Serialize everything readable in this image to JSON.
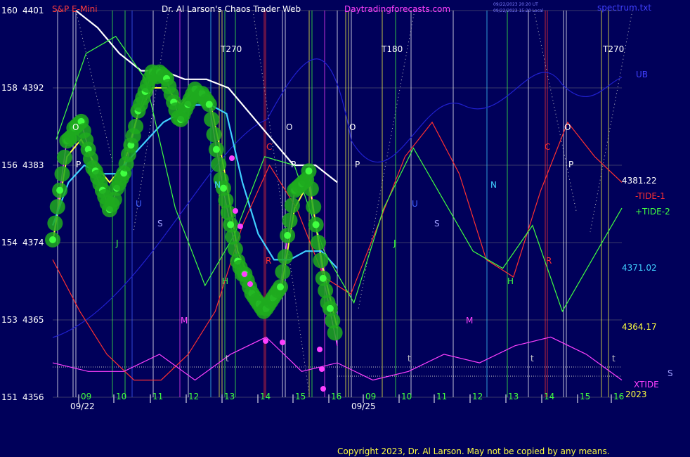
{
  "header": {
    "symbol": "S&P E-Mini",
    "title": "Dr. Al Larson's Chaos Trader Web",
    "site": "Daytradingforecasts.com",
    "timestamp_line1": "09/22/2023 20:20 UT",
    "timestamp_line2": "09/22/2023 15:20 Local",
    "topright": "spectrum.txt",
    "colors": {
      "symbol": "#ff3c3c",
      "title": "#ffffff",
      "site": "#ff40ff",
      "timestamp": "#7c7cff",
      "topright": "#4040ff"
    }
  },
  "left_axis": [
    {
      "cycle": "160",
      "price": "4401"
    },
    {
      "cycle": "158",
      "price": "4392"
    },
    {
      "cycle": "156",
      "price": "4383"
    },
    {
      "cycle": "154",
      "price": "4374"
    },
    {
      "cycle": "153",
      "price": "4365"
    },
    {
      "cycle": "151",
      "price": "4356"
    }
  ],
  "right_labels": {
    "ub": "UB",
    "price_white": "4381.22",
    "tide1": "-TIDE-1",
    "tide2": "+TIDE-2",
    "price_cyan": "4371.02",
    "price_yellow": "4364.17",
    "xtide": "XTIDE",
    "year": "2023",
    "s_edge": "S",
    "colors": {
      "ub": "#4040ff",
      "price_white": "#ffffff",
      "tide1": "#ff3030",
      "tide2": "#40ff40",
      "price_cyan": "#40d0ff",
      "price_yellow": "#ffff40",
      "xtide": "#ff40ff",
      "year": "#ffff40",
      "s_edge": "#a0a0ff"
    }
  },
  "hour_labels": [
    "09",
    "10",
    "11",
    "12",
    "13",
    "14",
    "15",
    "16",
    "09",
    "10",
    "11",
    "12",
    "13",
    "14",
    "15",
    "16"
  ],
  "date_labels": [
    "09/22",
    "09/25"
  ],
  "cycle_markers": [
    "T270",
    "T180",
    "T270"
  ],
  "planet_letters": [
    "O",
    "P",
    "O",
    "P",
    "O",
    "P",
    "O",
    "P",
    "U",
    "S",
    "U",
    "S",
    "J",
    "J",
    "N",
    "N",
    "M",
    "M",
    "H",
    "H",
    "C",
    "C",
    "R",
    "R",
    "t",
    "t",
    "t",
    "t"
  ],
  "copyright": "Copyright 2023, Dr. Al Larson. May not be copied by any means.",
  "chart_data": {
    "type": "line",
    "x_categories": [
      "09/22 09",
      "10",
      "11",
      "12",
      "13",
      "14",
      "15",
      "16",
      "09/25 09",
      "10",
      "11",
      "12",
      "13",
      "14",
      "15",
      "16"
    ],
    "y_axis_price": {
      "min": 4356,
      "max": 4401
    },
    "series": [
      {
        "name": "price",
        "color": "#ff40ff",
        "values": [
          4374,
          4386,
          4388,
          4382,
          4378,
          4382,
          4389,
          4394,
          4393,
          4388,
          4392,
          4390,
          4380,
          4372,
          4368,
          4366,
          4369,
          4380,
          4382,
          4370,
          4362
        ]
      },
      {
        "name": "fast average",
        "color": "#ffff40",
        "values": [
          4374,
          4384,
          4386,
          4383,
          4381,
          4383,
          4389,
          4392,
          4392,
          4390,
          4392,
          4391,
          4383,
          4373,
          4369,
          4367,
          4368,
          4378,
          4381,
          4371,
          4364
        ]
      },
      {
        "name": "mid average",
        "color": "#40d0ff",
        "values": [
          4376,
          4381,
          4383,
          4382,
          4382,
          4384,
          4386,
          4388,
          4389,
          4390,
          4390,
          4389,
          4381,
          4375,
          4372,
          4372,
          4373,
          4373,
          4371
        ]
      },
      {
        "name": "slow average",
        "color": "#ffffff",
        "values": [
          4401,
          4399,
          4396,
          4394,
          4394,
          4393,
          4393,
          4392,
          4389,
          4386,
          4383,
          4383,
          4381
        ]
      },
      {
        "name": "-TIDE-1",
        "color": "#ff3030",
        "values": [
          4372,
          4366,
          4361,
          4358,
          4358,
          4361,
          4366,
          4376,
          4383,
          4378,
          4370,
          4368,
          4376,
          4384,
          4388,
          4382,
          4372,
          4370,
          4380,
          4388,
          4384,
          4381
        ]
      },
      {
        "name": "+TIDE-2",
        "color": "#40ff40",
        "values": [
          4386,
          4396,
          4398,
          4393,
          4378,
          4369,
          4375,
          4384,
          4383,
          4373,
          4367,
          4378,
          4385,
          4379,
          4373,
          4371,
          4376,
          4366,
          4372,
          4378
        ]
      },
      {
        "name": "XTIDE",
        "color": "#ff40ff",
        "values": [
          4360,
          4359,
          4359,
          4361,
          4358,
          4361,
          4363,
          4359,
          4360,
          4358,
          4359,
          4361,
          4360,
          4362,
          4363,
          4361,
          4358
        ]
      }
    ]
  }
}
